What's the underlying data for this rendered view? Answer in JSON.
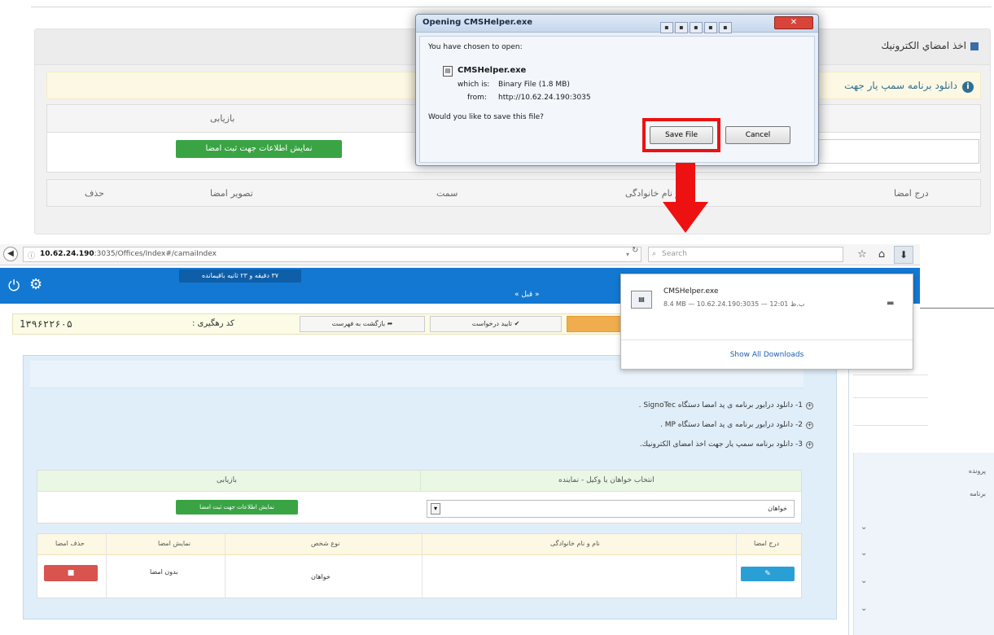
{
  "top": {
    "panel_title": "اخذ امضاي الكترونيك",
    "notice_text": "دانلود برنامه سمپ يار جهت",
    "col_restore": "بازيابى",
    "green_button": "نمايش اطلاعات جهت ثبت امضا",
    "headers": [
      "حذف",
      "تصوير امضا",
      "سمت",
      "نام و نام خانوادگى",
      "درج امضا"
    ]
  },
  "dialog": {
    "title": "Opening CMSHelper.exe",
    "chosen_text": "You have chosen to open:",
    "file_name": "CMSHelper.exe",
    "which_is_label": "which is:",
    "which_is_value": "Binary File (1.8 MB)",
    "from_label": "from:",
    "from_value": "http://10.62.24.190:3035",
    "question": "Would you like to save this file?",
    "save_label": "Save File",
    "cancel_label": "Cancel"
  },
  "browser": {
    "url_host": "10.62.24.190",
    "url_path": ":3035/Offices/Index#/camaiIndex",
    "search_placeholder": "Search"
  },
  "app": {
    "timer_text": "۳۷ دقيقه و ۲۳ ثانيه باقيمانده",
    "next_label": "« قبل »",
    "tracking_number": "1۳۹۶۲۲۶۰۵",
    "tracking_label": "كد رهگيرى :",
    "back_to_list": "بازگشت به فهرست",
    "confirm_request": "تاييد درخواست"
  },
  "instructions": [
    "1- دانلود درايور برنامه ى پد امضا دستگاه SignoTec .",
    "2- دانلود درايور برنامه ى پد امضا دستگاه MP .",
    "3- دانلود برنامه سمپ يار جهت اخذ امضاى الكترونيك."
  ],
  "table_a": {
    "col_restore": "بازيابى",
    "col_select": "انتخاب خواهان يا وكيل - نماينده",
    "green_button": "نمايش اطلاعات جهت ثبت امضا",
    "select_value": "خواهان"
  },
  "table_b": {
    "headers": [
      "حذف امضا",
      "نمايش امضا",
      "نوع شخص",
      "نام و نام خانوادگى",
      "درج امضا"
    ],
    "row": {
      "signature": "بدون امضا",
      "person_type": "خواهان"
    }
  },
  "downloads": {
    "file_name": "CMSHelper.exe",
    "meta": "8.4 MB — 10.62.24.190:3035 — 12:01 ب.ظ",
    "show_all": "Show All Downloads"
  },
  "side": {
    "item1": "پرونده",
    "item2": "برنامه"
  },
  "colors": {
    "header_blue": "#1378d1",
    "save_highlight": "#ee1111",
    "green": "#3aa445",
    "red": "#d9534f"
  }
}
